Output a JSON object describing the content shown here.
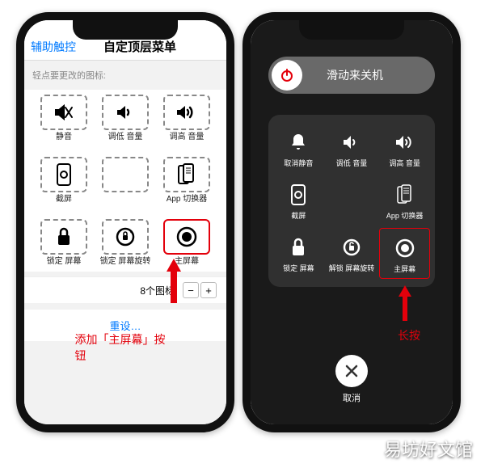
{
  "left": {
    "back": "辅助触控",
    "title": "自定顶层菜单",
    "subtitle": "轻点要更改的图标:",
    "cells": [
      {
        "name": "mute",
        "label": "静音"
      },
      {
        "name": "vol-down",
        "label": "调低\n音量"
      },
      {
        "name": "vol-up",
        "label": "调高\n音量"
      },
      {
        "name": "screenshot",
        "label": "截屏"
      },
      {
        "name": "empty",
        "label": ""
      },
      {
        "name": "app-switcher",
        "label": "App 切换器"
      },
      {
        "name": "lock-screen",
        "label": "锁定\n屏幕"
      },
      {
        "name": "lock-rotation",
        "label": "锁定\n屏幕旋转"
      },
      {
        "name": "home",
        "label": "主屏幕",
        "hl": true
      }
    ],
    "count": "8个图标",
    "reset": "重设…",
    "annotation": "添加「主屏幕」按钮"
  },
  "right": {
    "slide": "滑动来关机",
    "cells": [
      {
        "name": "unmute",
        "label": "取消静音"
      },
      {
        "name": "vol-down",
        "label": "调低\n音量"
      },
      {
        "name": "vol-up",
        "label": "调高\n音量"
      },
      {
        "name": "screenshot",
        "label": "截屏"
      },
      {
        "name": "empty",
        "label": ""
      },
      {
        "name": "app-switcher",
        "label": "App 切换器"
      },
      {
        "name": "lock-screen",
        "label": "锁定\n屏幕"
      },
      {
        "name": "unlock-rotation",
        "label": "解锁\n屏幕旋转"
      },
      {
        "name": "home",
        "label": "主屏幕",
        "hl": true
      }
    ],
    "cancel": "取消",
    "annotation": "长按"
  },
  "watermark": "易坊好文馆"
}
